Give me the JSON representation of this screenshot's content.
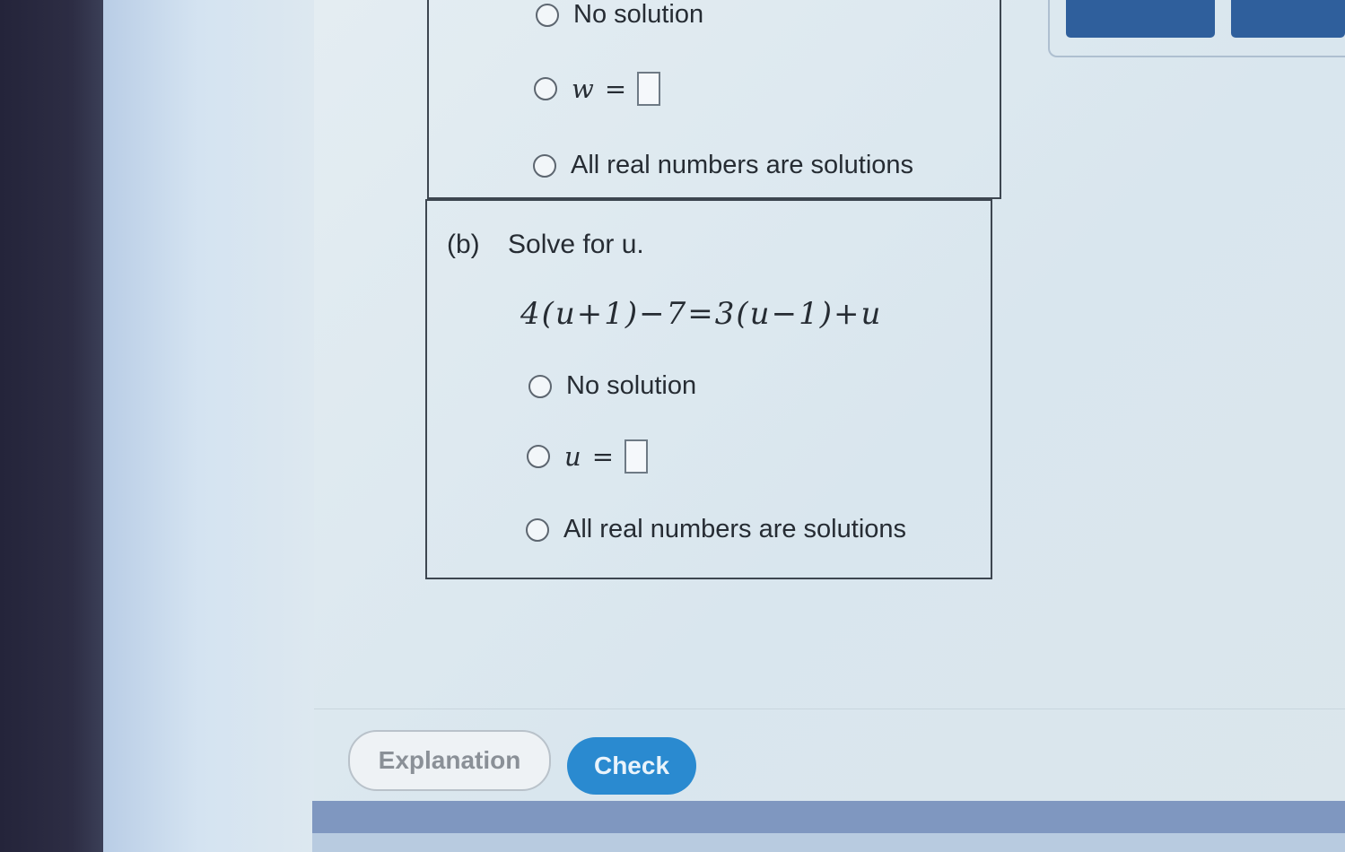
{
  "part_a": {
    "options": [
      {
        "label": "No solution"
      },
      {
        "variable": "w",
        "equals": "="
      },
      {
        "label": "All real numbers are solutions"
      }
    ]
  },
  "part_b": {
    "label": "(b)",
    "prompt": "Solve for u.",
    "equation": "4(u+1)−7=3(u−1)+u",
    "options": [
      {
        "label": "No solution"
      },
      {
        "variable": "u",
        "equals": "="
      },
      {
        "label": "All real numbers are solutions"
      }
    ]
  },
  "buttons": {
    "explanation": "Explanation",
    "check": "Check"
  },
  "colors": {
    "check_button": "#2a8ad0",
    "panel_border": "#3d4650",
    "top_buttons": "#2f5f9c"
  }
}
